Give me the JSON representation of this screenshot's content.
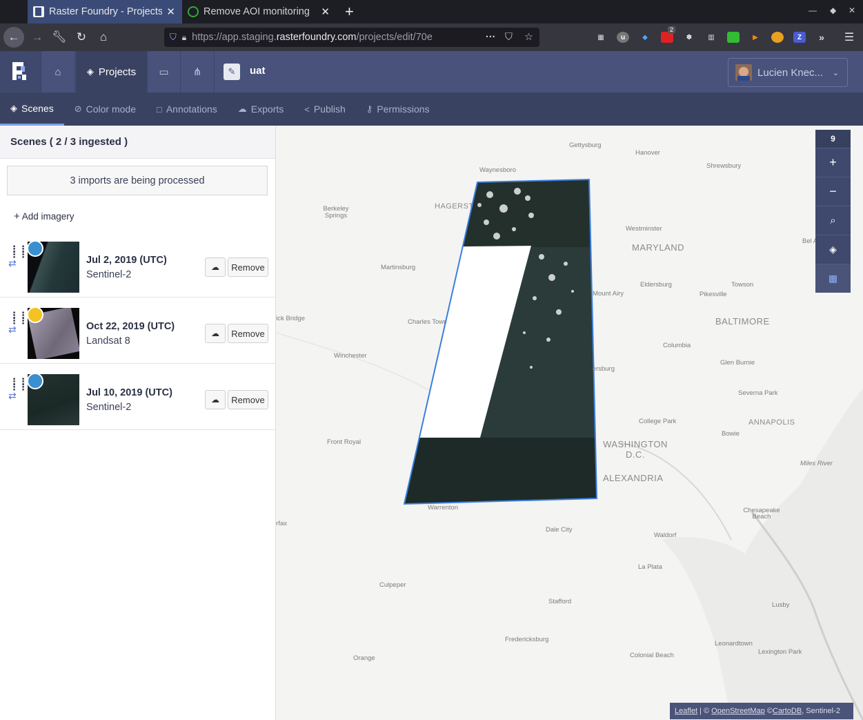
{
  "browser": {
    "tabs": [
      {
        "label": "Raster Foundry - Projects",
        "active": true
      },
      {
        "label": "Remove AOI monitoring",
        "active": false
      }
    ],
    "url_prefix": "https://app.staging.",
    "url_domain": "rasterfoundry.com",
    "url_path": "/projects/edit/70e",
    "new_tab": "+",
    "ext_badge": "2",
    "ext_z": "Z"
  },
  "app": {
    "nav_projects": "Projects",
    "project_name": "uat",
    "user_name": "Lucien Knec...",
    "subnav": [
      "Scenes",
      "Color mode",
      "Annotations",
      "Exports",
      "Publish",
      "Permissions"
    ]
  },
  "sidebar": {
    "title": "Scenes ( 2 / 3 ingested )",
    "processing": "3 imports are being processed",
    "add_imagery": "Add imagery",
    "scenes": [
      {
        "date": "Jul 2, 2019 (UTC)",
        "sensor": "Sentinel-2",
        "dot_color": "#3a8fd0",
        "remove": "Remove"
      },
      {
        "date": "Oct 22, 2019 (UTC)",
        "sensor": "Landsat 8",
        "dot_color": "#f4c224",
        "remove": "Remove"
      },
      {
        "date": "Jul 10, 2019 (UTC)",
        "sensor": "Sentinel-2",
        "dot_color": "#3a8fd0",
        "remove": "Remove"
      }
    ]
  },
  "map": {
    "zoom": "9",
    "labels": [
      "Gettysburg",
      "Hanover",
      "Shrewsbury",
      "Waynesboro",
      "HAGERSTOWN",
      "Berkeley Springs",
      "Westminster",
      "MARYLAND",
      "Bel Air",
      "Martinsburg",
      "Eldersburg",
      "Towson",
      "Mount Airy",
      "Pikesville",
      "Charles Town",
      "BALTIMORE",
      "Brunswick Bridge",
      "Columbia",
      "Winchester",
      "Gaithersburg",
      "Glen Burnie",
      "Severna Park",
      "College Park",
      "ANNAPOLIS",
      "Bowie",
      "Front Royal",
      "WASHINGTON D.C.",
      "Miles River",
      "ALEXANDRIA",
      "Warrenton",
      "Chesapeake Beach",
      "Fairfax",
      "Dale City",
      "Waldorf",
      "La Plata",
      "Culpeper",
      "Stafford",
      "Lusby",
      "Fredericksburg",
      "Leonardtown",
      "Lexington Park",
      "Colonial Beach",
      "Orange"
    ],
    "attribution_leaflet": "Leaflet",
    "attribution_osm": "OpenStreetMap",
    "attribution_carto": "CartoDB",
    "attribution_rest": ", Sentinel-2"
  }
}
